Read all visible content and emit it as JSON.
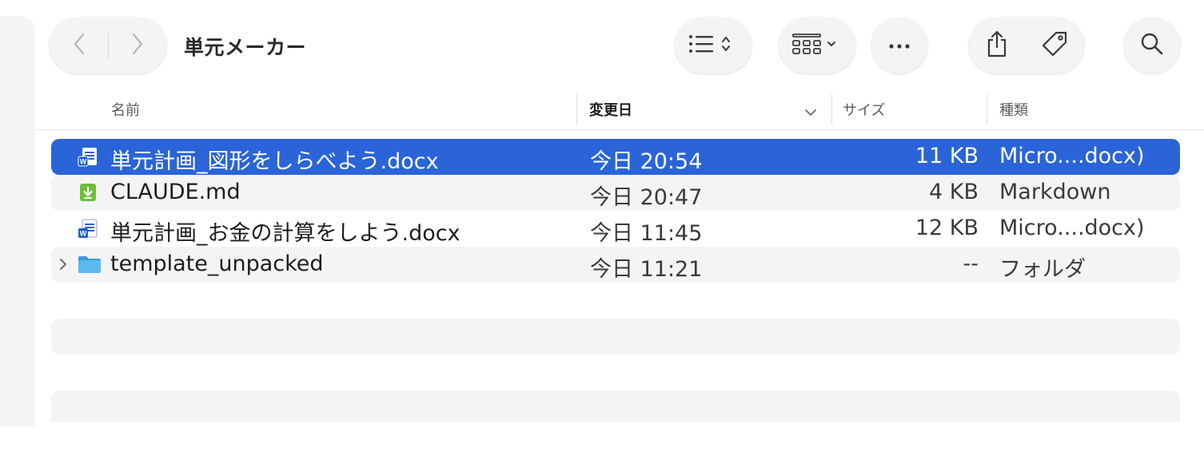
{
  "toolbar": {
    "folder_title": "単元メーカー",
    "back_icon": "chevron-left-icon",
    "forward_icon": "chevron-right-icon",
    "list_view_icon": "list-view-icon",
    "group_icon": "grid-group-icon",
    "more_icon": "ellipsis-icon",
    "share_icon": "share-icon",
    "tag_icon": "tag-icon",
    "search_icon": "search-icon"
  },
  "columns": {
    "name": "名前",
    "date": "変更日",
    "size": "サイズ",
    "kind": "種類"
  },
  "files": [
    {
      "name": "単元計画_図形をしらべよう.docx",
      "date": "今日 20:54",
      "size": "11 KB",
      "kind": "Micro....docx)",
      "icon": "word-doc-icon",
      "selected": true
    },
    {
      "name": "CLAUDE.md",
      "date": "今日 20:47",
      "size": "4 KB",
      "kind": "Markdown",
      "icon": "markdown-file-icon",
      "selected": false
    },
    {
      "name": "単元計画_お金の計算をしよう.docx",
      "date": "今日 11:45",
      "size": "12 KB",
      "kind": "Micro....docx)",
      "icon": "word-doc-icon",
      "selected": false
    },
    {
      "name": "template_unpacked",
      "date": "今日 11:21",
      "size": "--",
      "kind": "フォルダ",
      "icon": "folder-icon",
      "selected": false
    }
  ],
  "colors": {
    "selection": "#2a64d8",
    "alt_row": "#f4f4f5",
    "folder_blue": "#4fb0ea",
    "word_blue": "#1f5fbf",
    "markdown_green": "#6cbf3a"
  }
}
